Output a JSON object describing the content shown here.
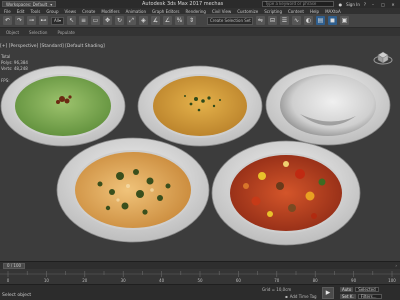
{
  "titlebar": {
    "workspace_label": "Workspaces: Default",
    "title": "Autodesk 3ds Max 2017    mechas",
    "search_placeholder": "Type a keyword or phrase",
    "signin": "Sign In",
    "help": "?",
    "min": "–",
    "max": "□",
    "close": "✕"
  },
  "menu": {
    "items": [
      "File",
      "Edit",
      "Tools",
      "Group",
      "Views",
      "Create",
      "Modifiers",
      "Animation",
      "Graph Editors",
      "Rendering",
      "Civil View",
      "Customize",
      "Scripting",
      "Content",
      "Help",
      "MAXtoA"
    ]
  },
  "toolbar": {
    "filter": "All",
    "selection_set_label": "Create Selection Set"
  },
  "ribbon": {
    "items": [
      "Object",
      "Selection",
      "Populate"
    ]
  },
  "viewport": {
    "label": "[+] [Perspective] [Standard] [Default Shading]",
    "stats_total": "Total",
    "stats_polys": "Polys:",
    "stats_verts": "Verts:",
    "stats_values": [
      "96,384",
      "48,248"
    ],
    "fps": "FPS:"
  },
  "timeslider": {
    "frame": "0 / 100",
    "arrow": "›"
  },
  "timeline": {
    "ticks": [
      0,
      10,
      20,
      30,
      40,
      50,
      60,
      70,
      80,
      90,
      100
    ]
  },
  "status": {
    "text": "Select object",
    "grid": "Grid = 10,0cm",
    "add_time_tag": "Add Time Tag",
    "auto": "Auto",
    "set_key": "Set K.",
    "selected": "Selected",
    "filters": "Filters..."
  },
  "colors": {
    "viewport_bg": "#3c3c3c",
    "plate": "#e4e4e4",
    "accent": "#2f5f8f"
  },
  "icons": [
    "undo-icon",
    "redo-icon",
    "link-icon",
    "select-icon",
    "move-icon",
    "rotate-icon",
    "scale-icon",
    "snap-icon",
    "mirror-icon",
    "render-icon",
    "play-icon"
  ]
}
